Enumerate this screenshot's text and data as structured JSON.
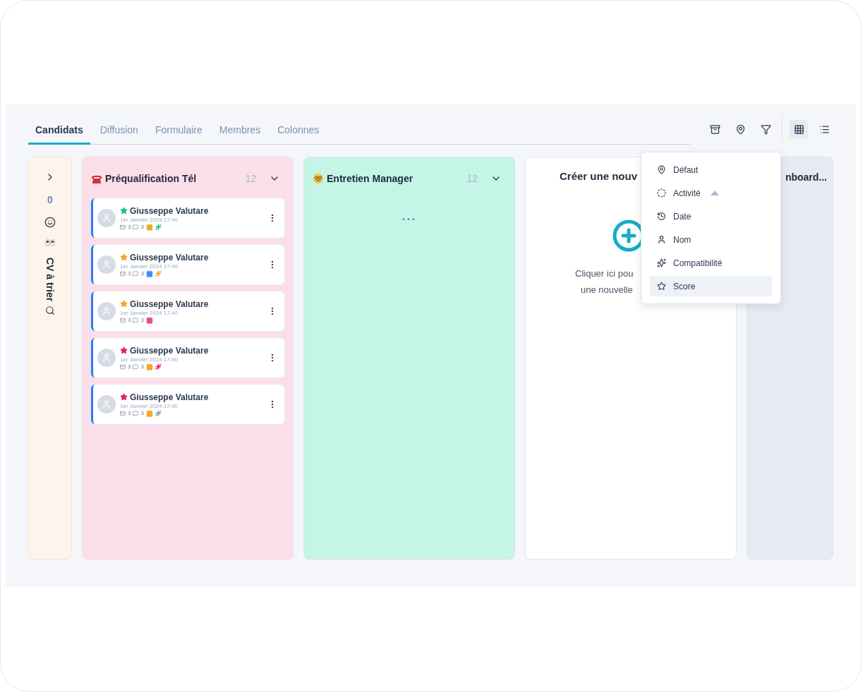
{
  "tabs": [
    {
      "label": "Candidats",
      "selected": true
    },
    {
      "label": "Diffusion",
      "selected": false
    },
    {
      "label": "Formulaire",
      "selected": false
    },
    {
      "label": "Membres",
      "selected": false
    },
    {
      "label": "Colonnes",
      "selected": false
    }
  ],
  "toolbar": [
    {
      "kind": "archive"
    },
    {
      "kind": "pin"
    },
    {
      "kind": "filter"
    }
  ],
  "views": [
    {
      "kind": "grid",
      "selected": true
    },
    {
      "kind": "list",
      "selected": false
    }
  ],
  "collapsed_column": {
    "count": "0",
    "title": "CV à trier"
  },
  "columns": [
    {
      "kind": "phone",
      "title": "Préqualification Tél",
      "count": "12",
      "color": "#fbdfe8",
      "cards": [
        {
          "name": "Giusseppe Valutare",
          "date": "1er Janvier 2024 17:40",
          "mails": "3",
          "comments": "3",
          "star": {
            "color": "#16c47f"
          },
          "calendar": {
            "color": "#f5a623"
          },
          "sparkle": {
            "color": "#16c47f"
          }
        },
        {
          "name": "Giusseppe Valutare",
          "date": "1er Janvier 2024 17:40",
          "mails": "3",
          "comments": "3",
          "star": {
            "color": "#f5a623"
          },
          "calendar": {
            "color": "#3b8ff5"
          },
          "sparkle": {
            "color": "#f5a623"
          }
        },
        {
          "name": "Giusseppe Valutare",
          "date": "1er Janvier 2024 17:40",
          "mails": "3",
          "comments": "3",
          "star": {
            "color": "#f5a623"
          },
          "calendar": {
            "color": "#ec4899"
          }
        },
        {
          "name": "Giusseppe Valutare",
          "date": "1er Janvier 2024 17:40",
          "mails": "3",
          "comments": "3",
          "star": {
            "color": "#e11d74"
          },
          "calendar": {
            "color": "#f5a623"
          },
          "sparkle": {
            "color": "#e11d74"
          }
        },
        {
          "name": "Giusseppe Valutare",
          "date": "1er Janvier 2024 17:40",
          "mails": "3",
          "comments": "3",
          "star": {
            "color": "#e11d74"
          },
          "calendar": {
            "color": "#f5a623"
          },
          "sparkle": {
            "color": "#8a99b0"
          }
        }
      ]
    },
    {
      "kind": "nerd",
      "title": "Entretien Manager",
      "count": "12",
      "color": "#c4f5e6",
      "loading": "···"
    }
  ],
  "create_column": {
    "title": "Créer une nouv",
    "text_lines": [
      "Cliquer ici pou",
      "une nouvelle"
    ]
  },
  "last_column": {
    "title": "nboard..."
  },
  "sort_menu": [
    {
      "kind": "pin",
      "label": "Défaut",
      "selected": false,
      "ascending": false
    },
    {
      "kind": "activity",
      "label": "Activité",
      "selected": false,
      "ascending": true
    },
    {
      "kind": "history",
      "label": "Date",
      "selected": false,
      "ascending": false
    },
    {
      "kind": "user",
      "label": "Nom",
      "selected": false,
      "ascending": false
    },
    {
      "kind": "sparkle",
      "label": "Compatibilité",
      "selected": false,
      "ascending": false
    },
    {
      "kind": "star",
      "label": "Score",
      "selected": true,
      "ascending": false
    }
  ]
}
